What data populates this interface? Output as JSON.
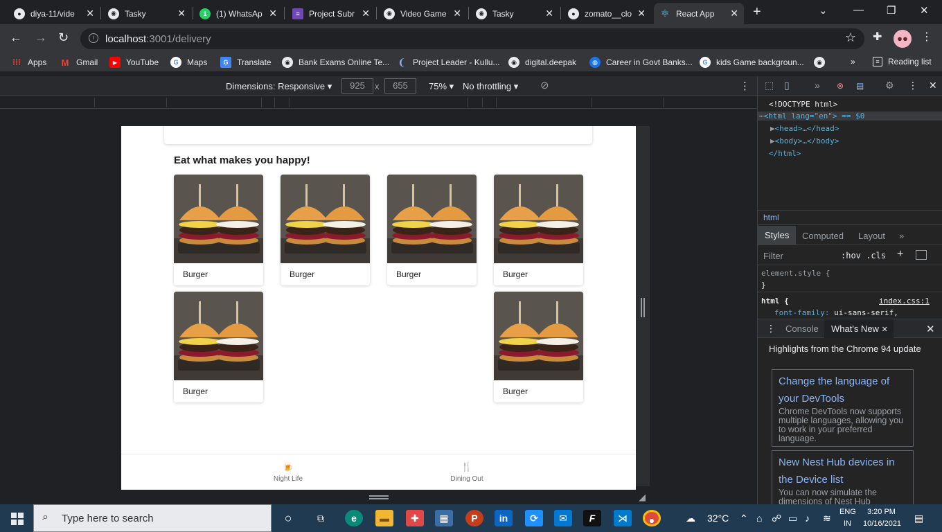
{
  "tabs": [
    {
      "title": "diya-11/vide",
      "icon": "github-icon"
    },
    {
      "title": "Tasky",
      "icon": "chromium-icon"
    },
    {
      "title": "(1) WhatsAp",
      "icon": "whatsapp-icon"
    },
    {
      "title": "Project Subr",
      "icon": "forms-icon"
    },
    {
      "title": "Video Game",
      "icon": "chromium-icon"
    },
    {
      "title": "Tasky",
      "icon": "chromium-icon"
    },
    {
      "title": "zomato__clo",
      "icon": "github-icon"
    },
    {
      "title": "React App",
      "icon": "react-icon",
      "active": true
    }
  ],
  "address_bar": {
    "host": "localhost",
    "rest": ":3001/delivery"
  },
  "bookmarks": [
    {
      "label": "Apps",
      "icon": "apps-grid-icon"
    },
    {
      "label": "Gmail",
      "icon": "gmail-icon"
    },
    {
      "label": "YouTube",
      "icon": "youtube-icon"
    },
    {
      "label": "Maps",
      "icon": "google-icon"
    },
    {
      "label": "Translate",
      "icon": "translate-icon"
    },
    {
      "label": "Bank Exams Online Te...",
      "icon": "chromium-icon"
    },
    {
      "label": "Project Leader - Kullu...",
      "icon": "feather-icon"
    },
    {
      "label": "digital.deepak",
      "icon": "chromium-icon"
    },
    {
      "label": "Career in Govt Banks...",
      "icon": "globe-icon"
    },
    {
      "label": "kids Game backgroun...",
      "icon": "google-icon"
    },
    {
      "label": "Reading list",
      "icon": "reading-list-icon"
    }
  ],
  "devbar": {
    "dimensions_label": "Dimensions: Responsive",
    "width": "925",
    "height": "655",
    "times": "x",
    "zoom": "75%",
    "throttling": "No throttling"
  },
  "page": {
    "heading": "Eat what makes you happy!",
    "cards": [
      "Burger",
      "Burger",
      "Burger",
      "Burger",
      "Burger",
      "Burger"
    ],
    "footer": [
      {
        "label": "Night Life",
        "icon": "beer-icon"
      },
      {
        "label": "Dining Out",
        "icon": "fork-knife-icon"
      }
    ]
  },
  "devtools": {
    "dom": [
      "<!DOCTYPE html>",
      "<html lang=\"en\"> == $0",
      "<head>…</head>",
      "<body>…</body>",
      "</html>"
    ],
    "breadcrumb": "html",
    "subtabs": [
      "Styles",
      "Computed",
      "Layout"
    ],
    "filter_placeholder": "Filter",
    "hov_cls": ":hov  .cls",
    "rules": {
      "element_style": "element.style {",
      "close": "}",
      "html_sel": "html {",
      "source": "index.css:1",
      "prop": "font-family:",
      "value": "ui-sans-serif,"
    },
    "drawer": {
      "console": "Console",
      "whats_new": "What's New"
    },
    "highlights": "Highlights from the Chrome 94 update",
    "news": [
      {
        "title": "Change the language of your DevTools",
        "desc": "Chrome DevTools now supports multiple languages, allowing you to work in your preferred language."
      },
      {
        "title": "New Nest Hub devices in the Device list",
        "desc": "You can now simulate the dimensions of Nest Hub"
      }
    ]
  },
  "taskbar": {
    "search_placeholder": "Type here to search",
    "weather": "32°C",
    "lang_top": "ENG",
    "lang_bottom": "IN",
    "time": "3:20 PM",
    "date": "10/16/2021"
  }
}
